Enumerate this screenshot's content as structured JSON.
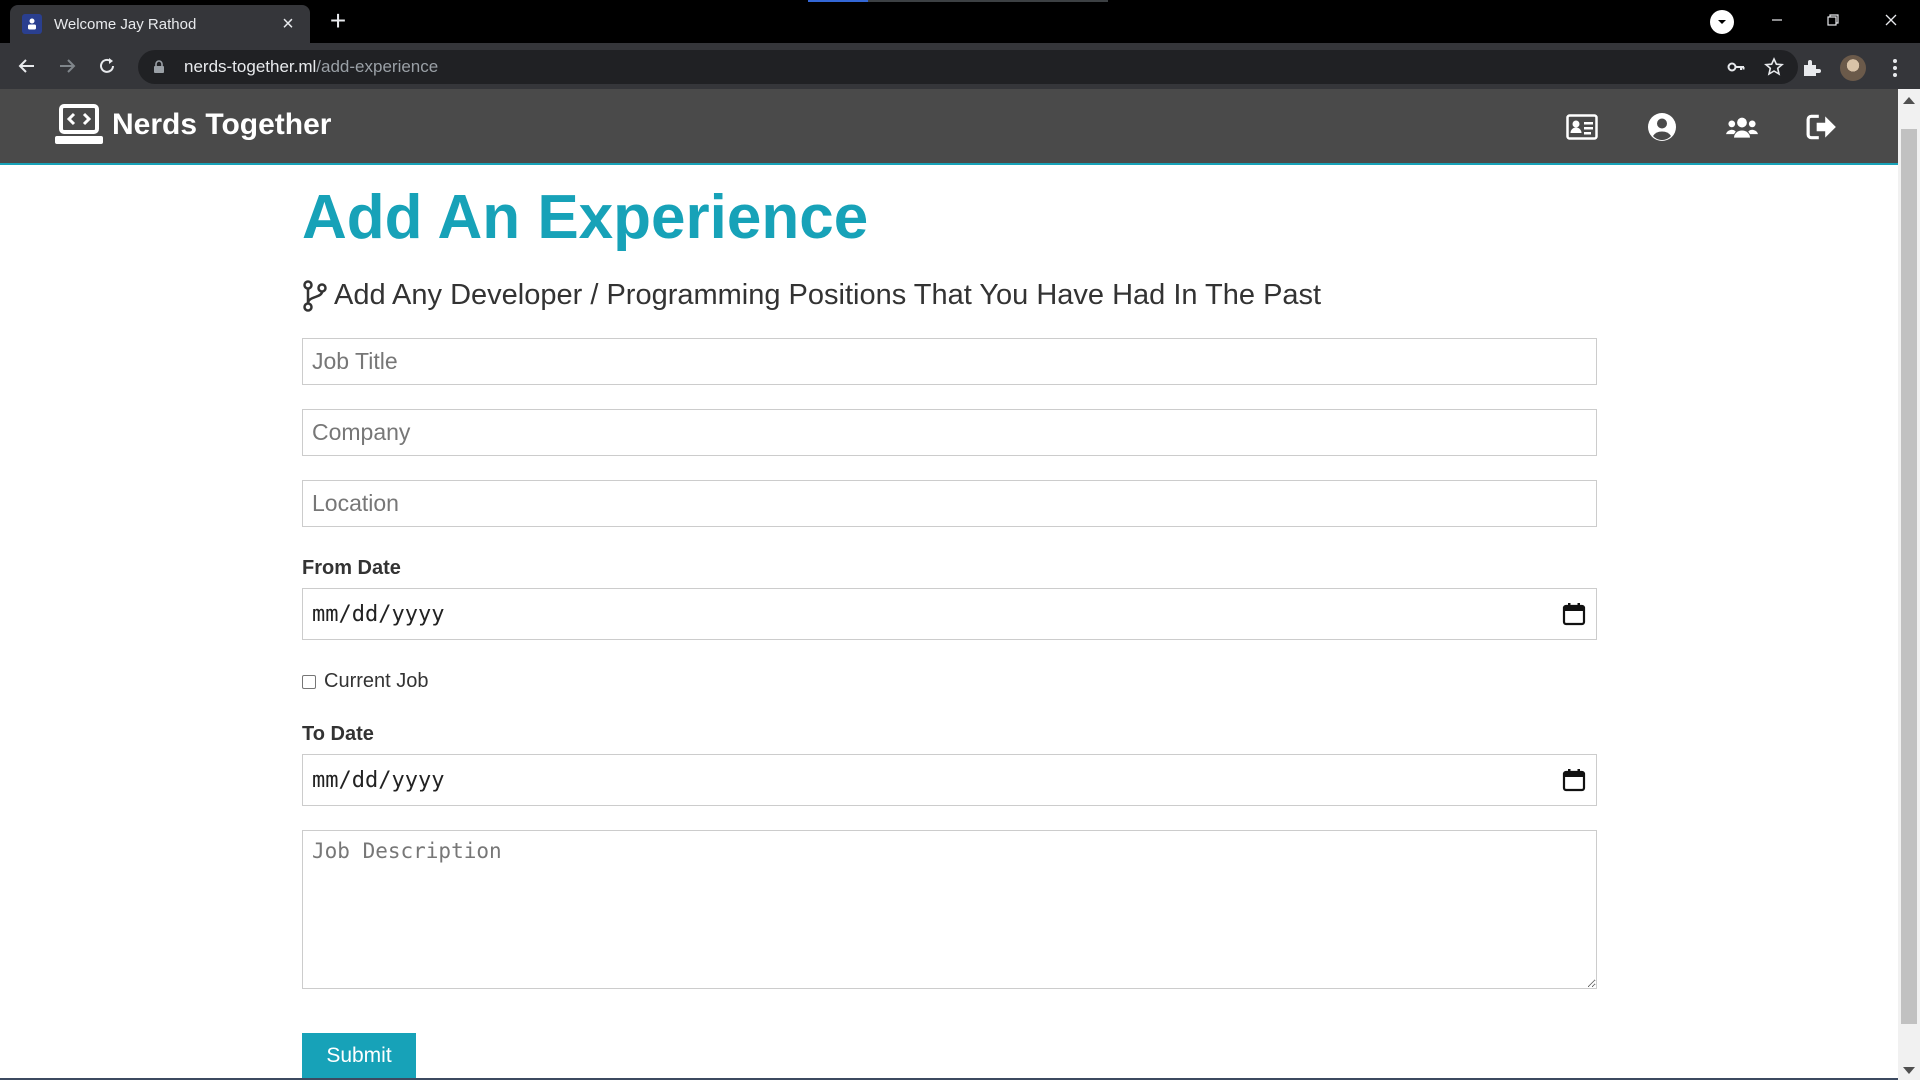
{
  "browser": {
    "tab_title": "Welcome Jay Rathod",
    "url_host": "nerds-together.ml",
    "url_path": "/add-experience"
  },
  "navbar": {
    "brand": "Nerds Together",
    "icons": [
      "id-card-icon",
      "user-circle-icon",
      "users-icon",
      "sign-out-icon"
    ]
  },
  "page": {
    "title": "Add An Experience",
    "lead": "Add Any Developer / Programming Positions That You Have Had In The Past",
    "job_title_placeholder": "Job Title",
    "company_placeholder": "Company",
    "location_placeholder": "Location",
    "from_date_label": "From Date",
    "from_date_value": "mm/dd/yyyy",
    "current_job_label": "Current Job",
    "to_date_label": "To Date",
    "to_date_value": "mm/dd/yyyy",
    "description_placeholder": "Job Description",
    "submit_label": "Submit"
  },
  "colors": {
    "accent": "#17a2b8",
    "navbar_bg": "#4a4a4a"
  }
}
